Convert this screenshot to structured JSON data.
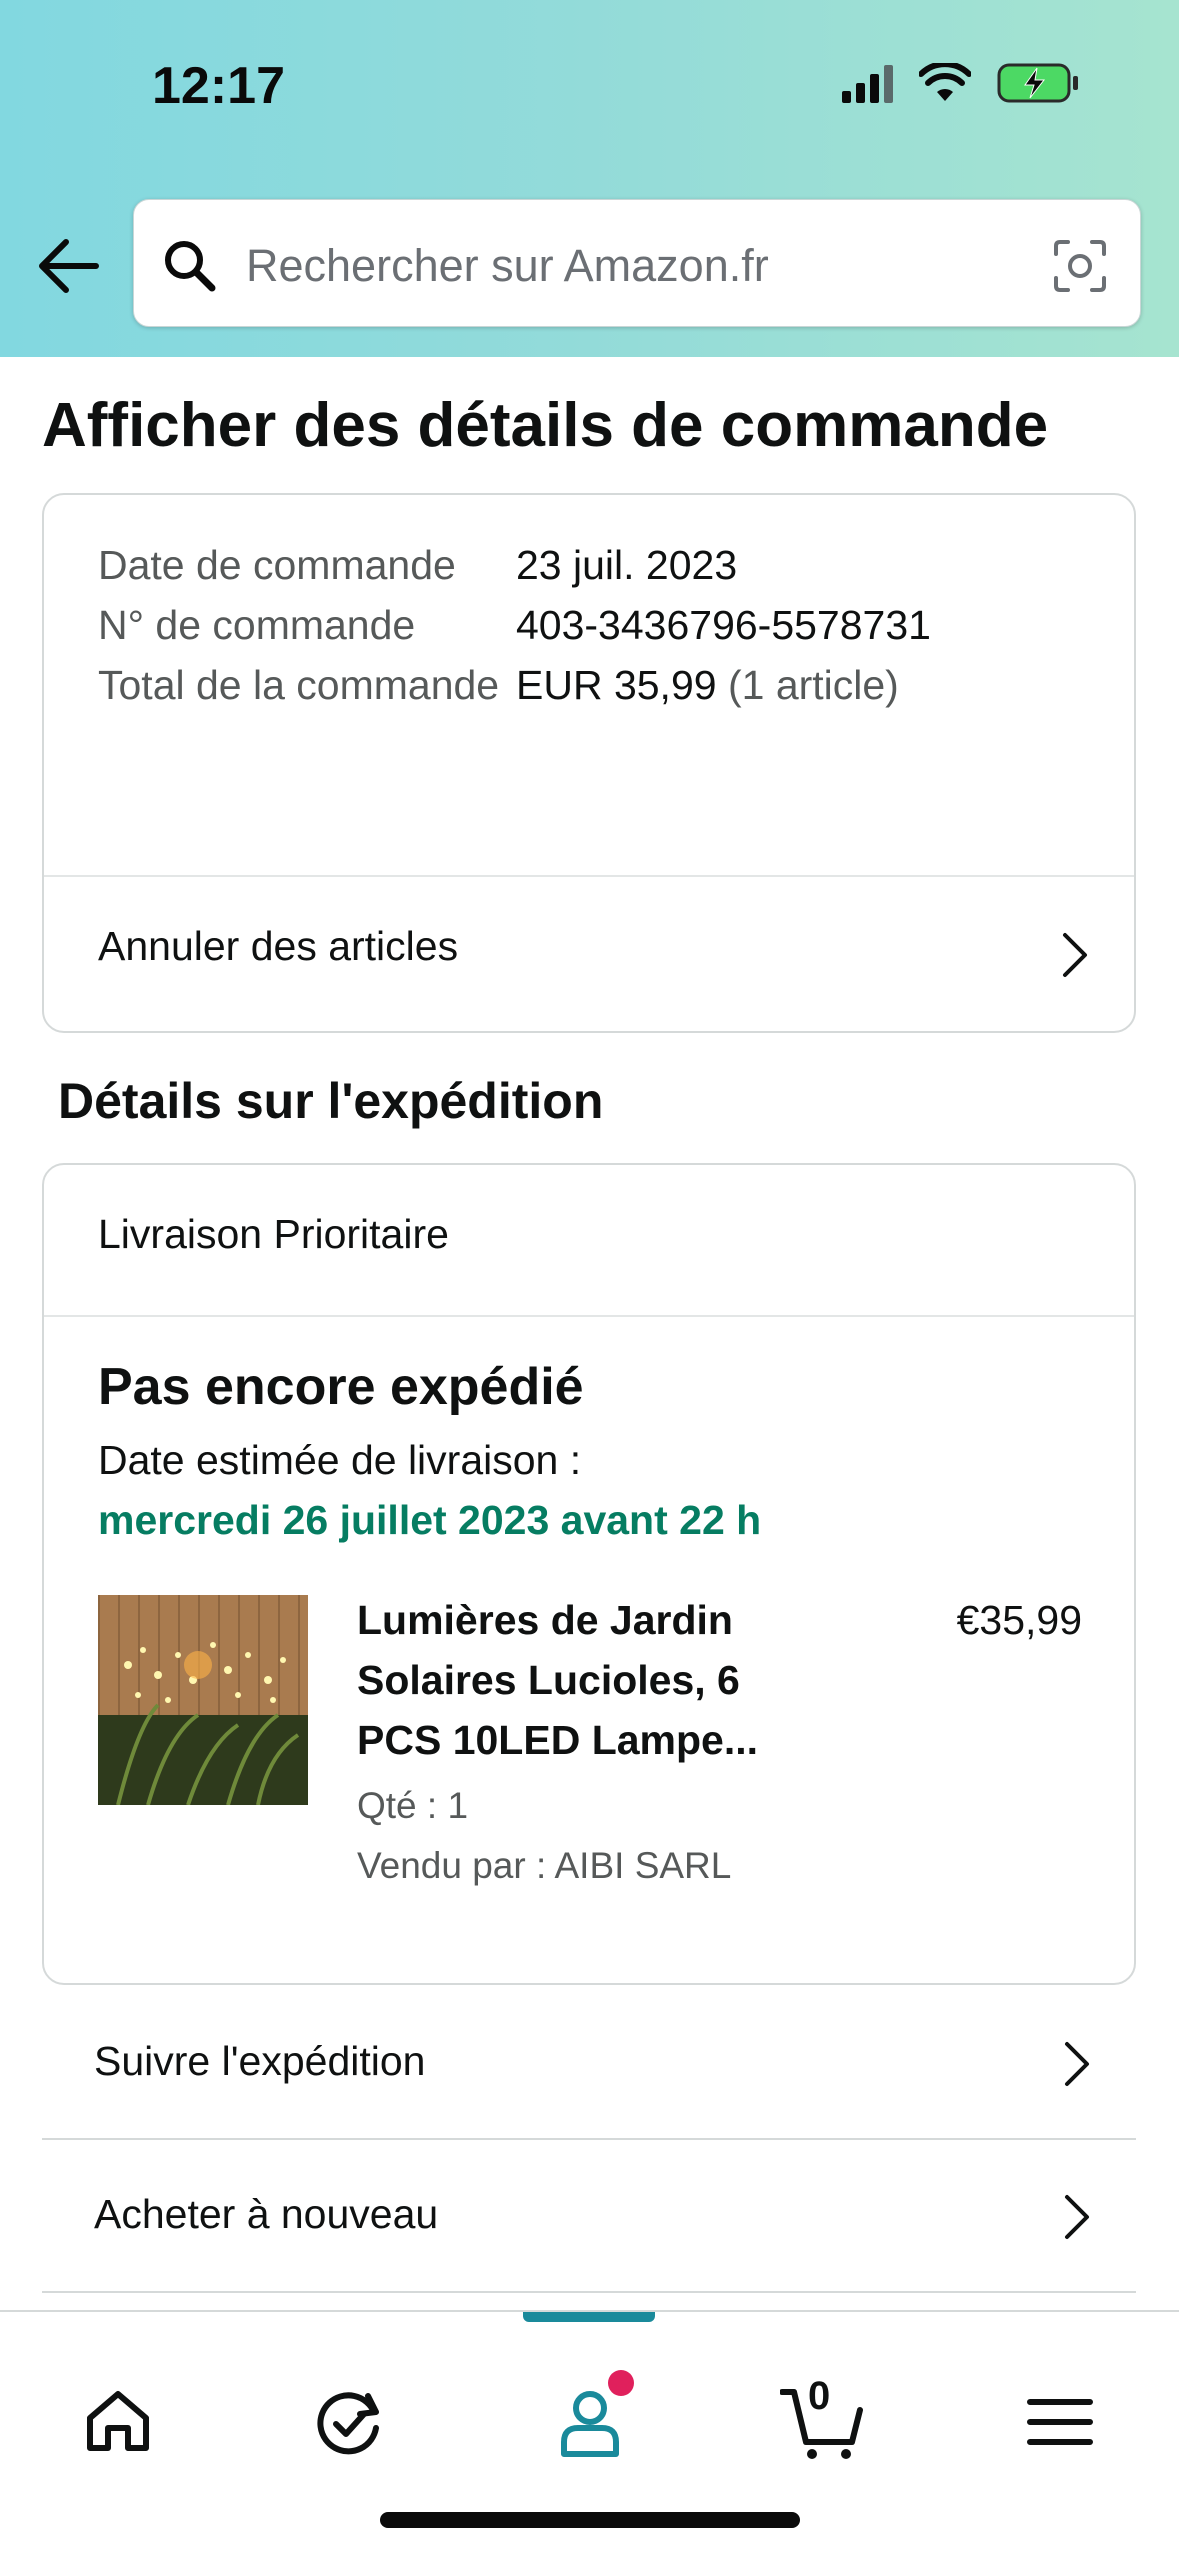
{
  "status_bar": {
    "time": "12:17"
  },
  "search": {
    "placeholder": "Rechercher sur Amazon.fr"
  },
  "page": {
    "title": "Afficher des détails de commande"
  },
  "order_summary": {
    "date_label": "Date de commande",
    "date_value": "23 juil. 2023",
    "number_label": "N° de commande",
    "number_value": "403-3436796-5578731",
    "total_label": "Total de la commande",
    "total_value": "EUR 35,99",
    "total_count": "(1 article)",
    "cancel_link": "Annuler des articles"
  },
  "shipping": {
    "section_title": "Détails sur l'expédition",
    "method": "Livraison Prioritaire",
    "status": "Pas encore expédié",
    "estimate_label": "Date estimée de livraison :",
    "estimate_date": "mercredi 26 juillet 2023 avant 22 h",
    "product": {
      "name": "Lumières de Jardin Solaires Lucioles, 6 PCS 10LED Lampe...",
      "price": "€35,99",
      "qty": "Qté : 1",
      "seller": "Vendu par : AIBI SARL"
    }
  },
  "actions": {
    "track": "Suivre l'expédition",
    "buy_again": "Acheter à nouveau"
  },
  "bottom_nav": {
    "cart_count": "0",
    "items": [
      "home-icon",
      "refresh-check-icon",
      "account-icon",
      "cart-icon",
      "menu-icon"
    ],
    "accent": "#1a8a9b",
    "notification_color": "#e0205c"
  },
  "colors": {
    "delivery_green": "#067d62",
    "header_start": "#82d8e0",
    "header_end": "#a6e4d0"
  }
}
